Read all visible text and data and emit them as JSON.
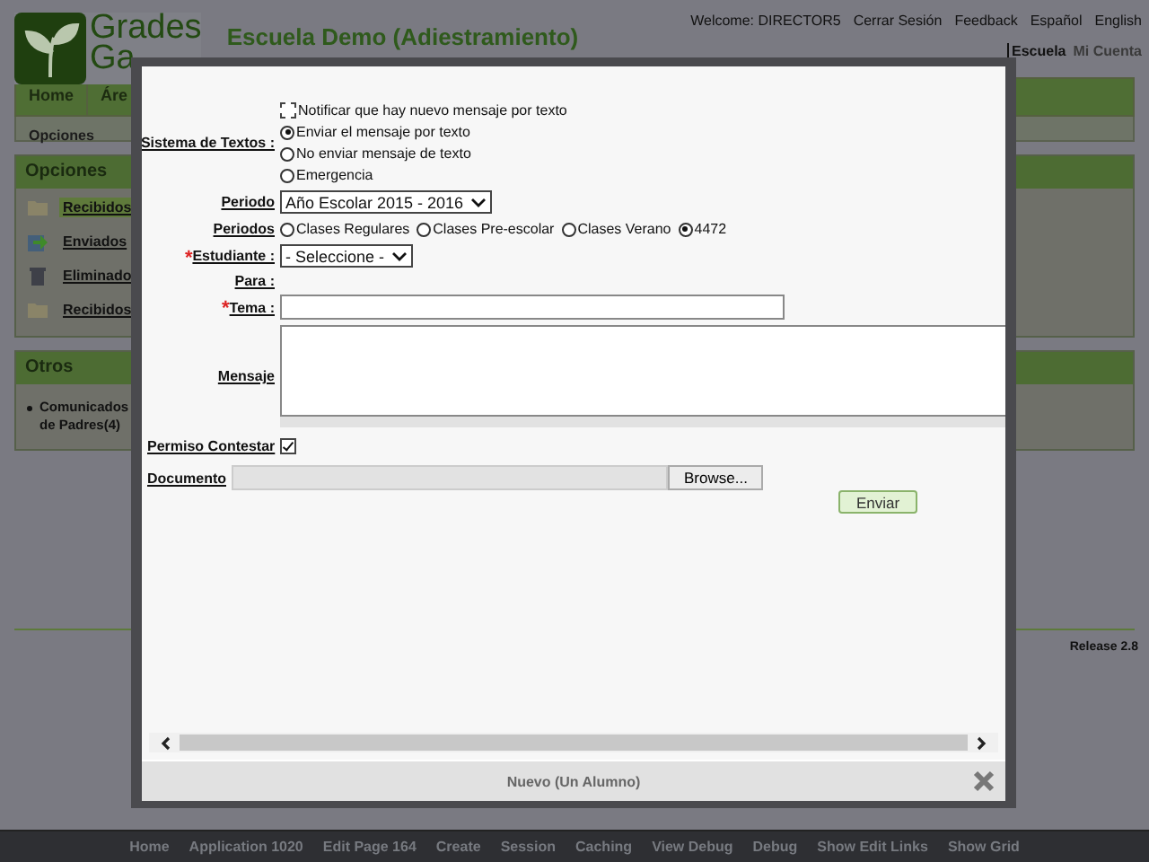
{
  "header": {
    "logo_line_1": "Grades",
    "logo_line_2": "Ga",
    "school": "Escuela Demo (Adiestramiento)",
    "top_links": [
      "Welcome: DIRECTOR5",
      "Cerrar Sesión",
      "Feedback",
      "Español",
      "English"
    ],
    "account_links": [
      {
        "label": "Escuela",
        "selected": true
      },
      {
        "label": "Mi Cuenta",
        "selected": false
      }
    ]
  },
  "nav": {
    "items": [
      "Home",
      "Áre"
    ],
    "sub": "Opciones"
  },
  "sidebar": {
    "title": "Opciones",
    "items": [
      {
        "label": "Recibidos",
        "kind": "folder",
        "selected": true
      },
      {
        "label": "Enviados",
        "kind": "send",
        "selected": false
      },
      {
        "label": "Eliminado",
        "kind": "trash",
        "selected": false
      },
      {
        "label": "Recibidos",
        "kind": "folder",
        "selected": false
      }
    ]
  },
  "otros": {
    "title": "Otros",
    "items": [
      "Comunicados de Padres(4)"
    ]
  },
  "release": "Release 2.8",
  "footer_links": [
    "Home",
    "Application 1020",
    "Edit Page 164",
    "Create",
    "Session",
    "Caching",
    "View Debug",
    "Debug",
    "Show Edit Links",
    "Show Grid"
  ],
  "dialog": {
    "title": "Nuevo (Un Alumno)",
    "rows": [
      {
        "kind": "stack",
        "label": "Sistema de Textos :",
        "options": [
          {
            "kind": "checkbox",
            "label": "Notificar que hay nuevo mensaje por texto",
            "checked": false
          },
          {
            "kind": "radio",
            "label": "Enviar el mensaje por texto",
            "selected": true
          },
          {
            "kind": "radio",
            "label": "No enviar mensaje de texto",
            "selected": false
          },
          {
            "kind": "radio",
            "label": "Emergencia",
            "selected": false
          }
        ]
      },
      {
        "kind": "select",
        "label": "Periodo",
        "value": "Año Escolar 2015 - 2016"
      },
      {
        "kind": "inline",
        "label": "Periodos",
        "options": [
          {
            "kind": "radio",
            "label": "Clases Regulares",
            "selected": false
          },
          {
            "kind": "radio",
            "label": "Clases Pre-escolar",
            "selected": false
          },
          {
            "kind": "radio",
            "label": "Clases Verano",
            "selected": false
          },
          {
            "kind": "radio",
            "label": "4472",
            "selected": true
          }
        ]
      },
      {
        "kind": "select",
        "label": "Estudiante :",
        "value": "- Seleccione -",
        "required_mark": "*"
      },
      {
        "kind": "plain",
        "label": "Para :"
      },
      {
        "kind": "text",
        "label": "Tema :",
        "required_mark": "*"
      },
      {
        "kind": "textarea",
        "label": "Mensaje"
      },
      {
        "kind": "checkbox",
        "label": "Permiso Contestar",
        "checked": true
      },
      {
        "kind": "file",
        "label": "Documento",
        "button": "Browse..."
      }
    ],
    "submit": "Enviar"
  }
}
